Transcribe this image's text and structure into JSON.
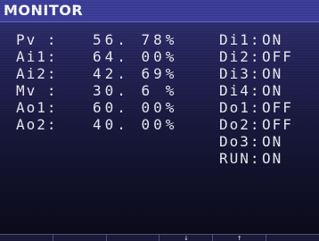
{
  "title": "MONITOR",
  "analog": [
    {
      "label": "Pv :",
      "value": "56. 78%"
    },
    {
      "label": "Ai1:",
      "value": "64. 00%"
    },
    {
      "label": "Ai2:",
      "value": "42. 69%"
    },
    {
      "label": "Mv :",
      "value": "30. 6 %"
    },
    {
      "label": "Ao1:",
      "value": "60. 00%"
    },
    {
      "label": "Ao2:",
      "value": "40. 00%"
    }
  ],
  "digital": [
    {
      "label": "Di1:",
      "state": "ON"
    },
    {
      "label": "Di2:",
      "state": "OFF"
    },
    {
      "label": "Di3:",
      "state": "ON"
    },
    {
      "label": "Di4:",
      "state": "ON"
    },
    {
      "label": "Do1:",
      "state": "OFF"
    },
    {
      "label": "Do2:",
      "state": "OFF"
    },
    {
      "label": "Do3:",
      "state": "ON"
    },
    {
      "label": "RUN:",
      "state": "ON"
    }
  ],
  "softkeys": [
    "",
    "",
    "",
    "↓",
    "↑",
    ""
  ]
}
